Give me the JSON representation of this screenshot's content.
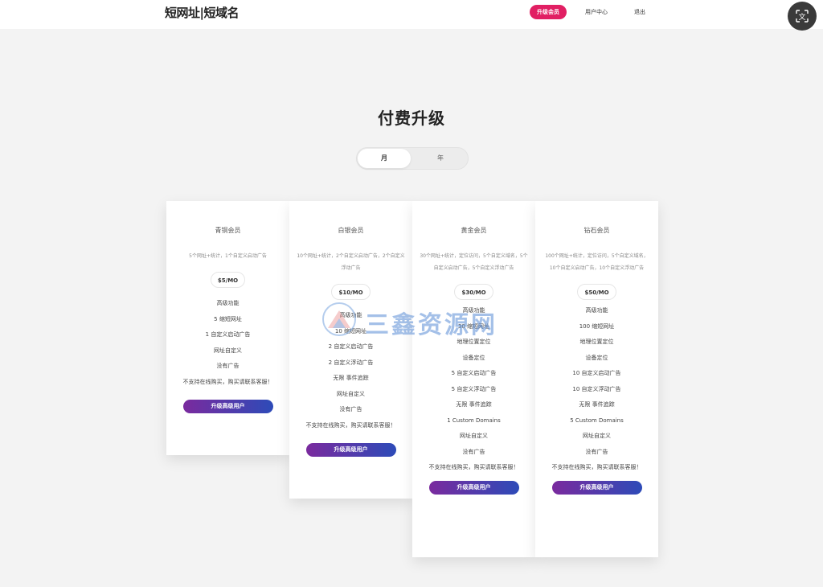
{
  "header": {
    "brand": "短网址|短域名",
    "nav": {
      "upgrade": "升级会员",
      "user_center": "用户中心",
      "logout": "退出"
    }
  },
  "translate_icon": "translate-icon",
  "page_title": "付费升级",
  "billing_toggle": {
    "monthly": "月",
    "yearly": "年"
  },
  "watermark": "三鑫资源网",
  "plans": [
    {
      "name": "青铜会员",
      "desc": "5个网址+统计，1个自定义启动广告",
      "price": "$5/MO",
      "features": [
        "高级功能",
        "5 缩短网址",
        "1 自定义启动广告",
        "网址自定义",
        "没有广告",
        "不支持在线购买，购买请联系客服！"
      ],
      "button": "升级高级用户"
    },
    {
      "name": "白银会员",
      "desc": "10个网址+统计，2个自定义启动广告，2个自定义浮动广告",
      "price": "$10/MO",
      "features": [
        "高级功能",
        "10 缩短网址",
        "2 自定义启动广告",
        "2 自定义浮动广告",
        "无限 事件追踪",
        "网址自定义",
        "没有广告",
        "不支持在线购买，购买请联系客服！"
      ],
      "button": "升级高级用户"
    },
    {
      "name": "黄金会员",
      "desc": "30个网址+统计，定位访问，5个自定义域名，5个自定义启动广告，5个自定义浮动广告",
      "price": "$30/MO",
      "features": [
        "高级功能",
        "30 缩短网址",
        "地理位置定位",
        "设备定位",
        "5 自定义启动广告",
        "5 自定义浮动广告",
        "无限 事件追踪",
        "1 Custom Domains",
        "网址自定义",
        "没有广告",
        "不支持在线购买，购买请联系客服！"
      ],
      "button": "升级高级用户"
    },
    {
      "name": "钻石会员",
      "desc": "100个网址+统计，定位访问，5个自定义域名，10个自定义启动广告，10个自定义浮动广告",
      "price": "$50/MO",
      "features": [
        "高级功能",
        "100 缩短网址",
        "地理位置定位",
        "设备定位",
        "10 自定义启动广告",
        "10 自定义浮动广告",
        "无限 事件追踪",
        "5 Custom Domains",
        "网址自定义",
        "没有广告",
        "不支持在线购买，购买请联系客服！"
      ],
      "button": "升级高级用户"
    }
  ]
}
